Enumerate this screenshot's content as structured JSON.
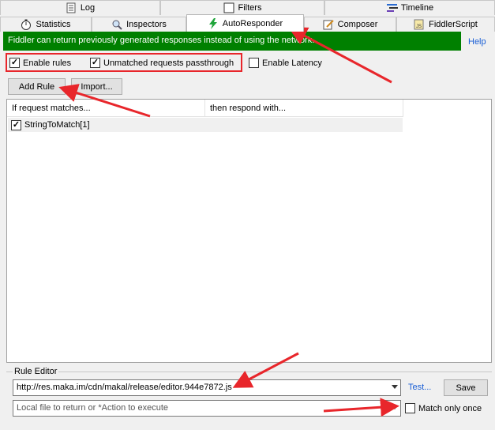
{
  "tabs_row1": [
    {
      "label": "Log",
      "icon": "log-icon"
    },
    {
      "label": "Filters",
      "icon": "filters-icon"
    },
    {
      "label": "Timeline",
      "icon": "timeline-icon"
    }
  ],
  "tabs_row2": [
    {
      "label": "Statistics",
      "icon": "stopwatch-icon"
    },
    {
      "label": "Inspectors",
      "icon": "inspectors-icon"
    },
    {
      "label": "AutoResponder",
      "icon": "lightning-icon"
    },
    {
      "label": "Composer",
      "icon": "composer-icon"
    },
    {
      "label": "FiddlerScript",
      "icon": "script-icon"
    }
  ],
  "banner": {
    "text": "Fiddler can return previously generated responses instead of using the network.",
    "help": "Help"
  },
  "options": {
    "enable_rules": "Enable rules",
    "enable_rules_checked": true,
    "unmatched_passthrough": "Unmatched requests passthrough",
    "unmatched_checked": true,
    "enable_latency": "Enable Latency",
    "latency_checked": false
  },
  "buttons": {
    "add_rule": "Add Rule",
    "import": "Import..."
  },
  "rules_table": {
    "columns": [
      "If request matches...",
      "then respond with..."
    ],
    "rows": [
      {
        "match": "StringToMatch[1]",
        "respond": "",
        "checked": true
      }
    ]
  },
  "rule_editor": {
    "title": "Rule Editor",
    "match_value": "http://res.maka.im/cdn/makal/release/editor.944e7872.js",
    "test_link": "Test...",
    "save": "Save",
    "action_placeholder": "Local file to return or *Action to execute",
    "match_only_once": "Match only once",
    "match_only_once_checked": false
  },
  "colors": {
    "banner_green": "#008000",
    "annotation_red": "#e8262b",
    "link_blue": "#1a5fd6"
  }
}
